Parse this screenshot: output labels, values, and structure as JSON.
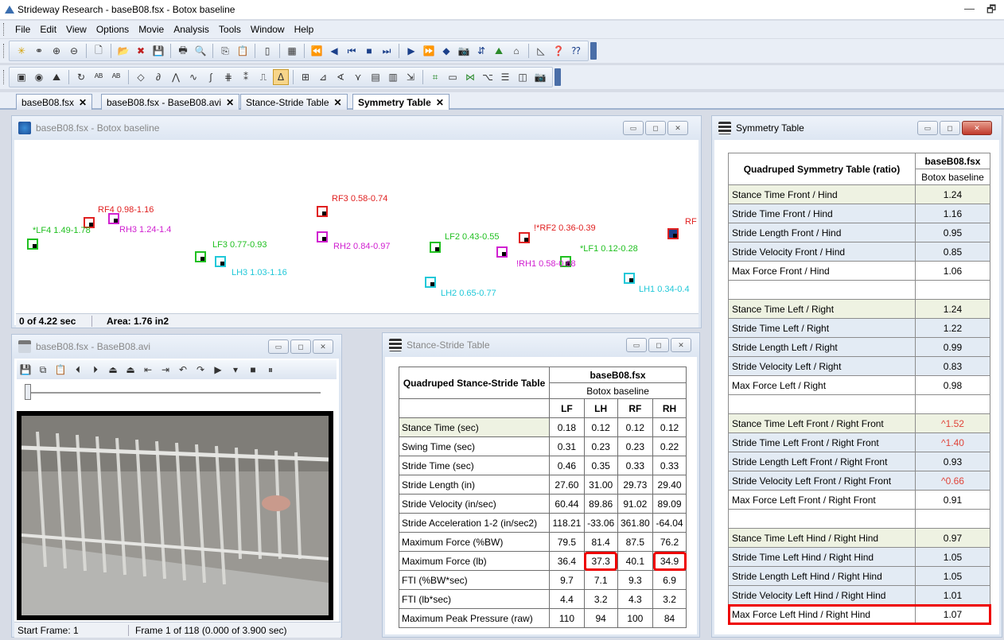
{
  "app": {
    "title": "Strideway Research - baseB08.fsx - Botox  baseline",
    "window_controls": [
      "—",
      "🗗"
    ]
  },
  "menu": [
    "File",
    "Edit",
    "View",
    "Options",
    "Movie",
    "Analysis",
    "Tools",
    "Window",
    "Help"
  ],
  "tabs": [
    {
      "label": "baseB08.fsx",
      "active": false
    },
    {
      "label": "baseB08.fsx - BaseB08.avi",
      "active": false
    },
    {
      "label": "Stance-Stride Table",
      "active": false
    },
    {
      "label": "Symmetry Table",
      "active": true
    }
  ],
  "map_window": {
    "title": "baseB08.fsx - Botox  baseline",
    "status_time": "0 of 4.22 sec",
    "status_area": "Area: 1.76 in2",
    "tracks": [
      {
        "label": "RF4 0.98-1.16",
        "color": "#e02020"
      },
      {
        "label": "RH3 1.24-1.4",
        "color": "#d020d0"
      },
      {
        "label": "*LF4 1.49-1.78",
        "color": "#20c020"
      },
      {
        "label": "RF3 0.58-0.74",
        "color": "#e02020"
      },
      {
        "label": "RH2 0.84-0.97",
        "color": "#d020d0"
      },
      {
        "label": "LF3 0.77-0.93",
        "color": "#20c020"
      },
      {
        "label": "LH3 1.03-1.16",
        "color": "#20c8d8"
      },
      {
        "label": "LF2 0.43-0.55",
        "color": "#20c020"
      },
      {
        "label": "!*RF2 0.36-0.39",
        "color": "#e02020"
      },
      {
        "label": "*LF1 0.12-0.28",
        "color": "#20c020"
      },
      {
        "label": "!RH1 0.58-0.68",
        "color": "#d020d0"
      },
      {
        "label": "LH2 0.65-0.77",
        "color": "#20c8d8"
      },
      {
        "label": "LH1 0.34-0.4",
        "color": "#20c8d8"
      },
      {
        "label": "RF",
        "color": "#e02020"
      }
    ]
  },
  "video_window": {
    "title": "baseB08.fsx - BaseB08.avi",
    "start_frame": "Start Frame: 1",
    "frame_info": "Frame 1 of 118  (0.000 of 3.900 sec)"
  },
  "stance_stride": {
    "title": "Stance-Stride Table",
    "header": "Quadruped Stance-Stride Table",
    "file": "baseB08.fsx",
    "condition": "Botox baseline",
    "columns": [
      "LF",
      "LH",
      "RF",
      "RH"
    ],
    "rows": [
      {
        "label": "Stance Time (sec)",
        "values": [
          "0.18",
          "0.12",
          "0.12",
          "0.12"
        ]
      },
      {
        "label": "Swing Time (sec)",
        "values": [
          "0.31",
          "0.23",
          "0.23",
          "0.22"
        ]
      },
      {
        "label": "Stride Time (sec)",
        "values": [
          "0.46",
          "0.35",
          "0.33",
          "0.33"
        ]
      },
      {
        "label": "Stride Length (in)",
        "values": [
          "27.60",
          "31.00",
          "29.73",
          "29.40"
        ]
      },
      {
        "label": "Stride Velocity (in/sec)",
        "values": [
          "60.44",
          "89.86",
          "91.02",
          "89.09"
        ]
      },
      {
        "label": "Stride Acceleration 1-2 (in/sec2)",
        "values": [
          "118.21",
          "-33.06",
          "361.80",
          "-64.04"
        ]
      },
      {
        "label": "Maximum Force (%BW)",
        "values": [
          "79.5",
          "81.4",
          "87.5",
          "76.2"
        ]
      },
      {
        "label": "Maximum Force (lb)",
        "values": [
          "36.4",
          "37.3",
          "40.1",
          "34.9"
        ]
      },
      {
        "label": "FTI (%BW*sec)",
        "values": [
          "9.7",
          "7.1",
          "9.3",
          "6.9"
        ]
      },
      {
        "label": "FTI (lb*sec)",
        "values": [
          "4.4",
          "3.2",
          "4.3",
          "3.2"
        ]
      },
      {
        "label": "Maximum Peak Pressure (raw)",
        "values": [
          "110",
          "94",
          "100",
          "84"
        ]
      }
    ]
  },
  "symmetry": {
    "title": "Symmetry Table",
    "header": "Quadruped Symmetry Table (ratio)",
    "file": "baseB08.fsx",
    "condition": "Botox baseline",
    "groups": [
      [
        {
          "label": "Stance Time Front / Hind",
          "value": "1.24",
          "flag": false
        },
        {
          "label": "Stride Time Front / Hind",
          "value": "1.16",
          "flag": false
        },
        {
          "label": "Stride Length Front / Hind",
          "value": "0.95",
          "flag": false
        },
        {
          "label": "Stride Velocity Front / Hind",
          "value": "0.85",
          "flag": false
        },
        {
          "label": "Max Force Front / Hind",
          "value": "1.06",
          "flag": false
        }
      ],
      [
        {
          "label": "Stance Time Left / Right",
          "value": "1.24",
          "flag": false
        },
        {
          "label": "Stride Time Left / Right",
          "value": "1.22",
          "flag": false
        },
        {
          "label": "Stride Length Left / Right",
          "value": "0.99",
          "flag": false
        },
        {
          "label": "Stride Velocity Left / Right",
          "value": "0.83",
          "flag": false
        },
        {
          "label": "Max Force Left / Right",
          "value": "0.98",
          "flag": false
        }
      ],
      [
        {
          "label": "Stance Time Left Front / Right Front",
          "value": "^1.52",
          "flag": true
        },
        {
          "label": "Stride Time Left Front / Right Front",
          "value": "^1.40",
          "flag": true
        },
        {
          "label": "Stride Length Left Front / Right Front",
          "value": "0.93",
          "flag": false
        },
        {
          "label": "Stride Velocity Left Front / Right Front",
          "value": "^0.66",
          "flag": true
        },
        {
          "label": "Max Force Left Front / Right Front",
          "value": "0.91",
          "flag": false
        }
      ],
      [
        {
          "label": "Stance Time Left Hind / Right Hind",
          "value": "0.97",
          "flag": false
        },
        {
          "label": "Stride Time Left Hind / Right Hind",
          "value": "1.05",
          "flag": false
        },
        {
          "label": "Stride Length Left Hind / Right Hind",
          "value": "1.05",
          "flag": false
        },
        {
          "label": "Stride Velocity Left Hind / Right Hind",
          "value": "1.01",
          "flag": false
        },
        {
          "label": "Max Force Left Hind / Right Hind",
          "value": "1.07",
          "flag": false
        }
      ]
    ]
  }
}
